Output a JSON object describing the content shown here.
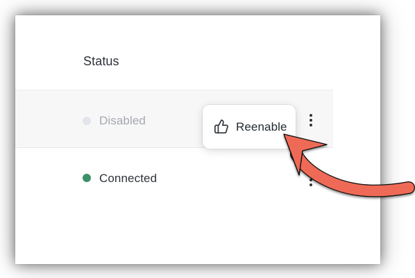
{
  "table": {
    "column_header": "Status",
    "rows": [
      {
        "status": "Disabled",
        "status_color": "#e2e5ea",
        "menu_icon": "more-vertical-icon"
      },
      {
        "status": "Connected",
        "status_color": "#3e9168",
        "menu_icon": "more-vertical-icon"
      }
    ]
  },
  "popover": {
    "action_label": "Reenable",
    "action_icon": "thumbs-up-icon"
  },
  "annotation": {
    "arrow_color": "#ef6b57",
    "arrow_icon": "pointer-arrow-icon"
  }
}
